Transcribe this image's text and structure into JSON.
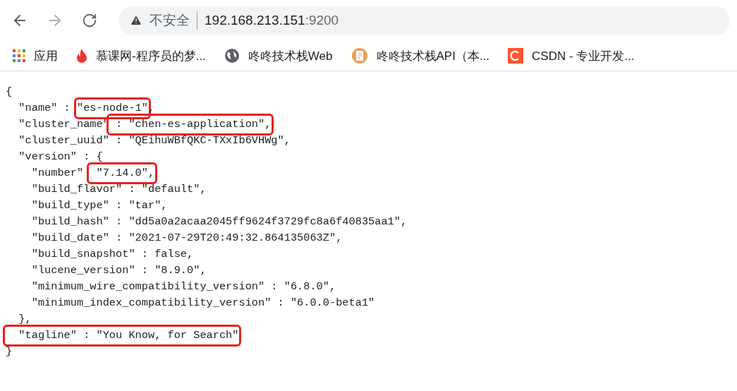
{
  "address_bar": {
    "security_label": "不安全",
    "url_host": "192.168.213.151",
    "url_port": ":9200"
  },
  "bookmarks": [
    {
      "kind": "apps",
      "label": "应用"
    },
    {
      "kind": "flame",
      "label": "慕课网-程序员的梦..."
    },
    {
      "kind": "globe",
      "label": "咚咚技术栈Web"
    },
    {
      "kind": "document",
      "label": "咚咚技术栈API（本..."
    },
    {
      "kind": "csdn",
      "label": "CSDN - 专业开发..."
    }
  ],
  "json_lines": [
    [
      {
        "text": "{",
        "marked": false
      }
    ],
    [
      {
        "text": "  \"name\" : ",
        "marked": false
      },
      {
        "text": "\"es-node-1\"",
        "marked": true
      },
      {
        "text": ",",
        "marked": false
      }
    ],
    [
      {
        "text": "  \"cluster_name\"",
        "marked": false
      },
      {
        "text": " : \"chen-es-application\",",
        "marked": true
      }
    ],
    [
      {
        "text": "  \"cluster_uuid\" : \"QEihuWBfQKC-TXxIb6VHWg\",",
        "marked": false
      }
    ],
    [
      {
        "text": "  \"version\" : {",
        "marked": false
      }
    ],
    [
      {
        "text": "    \"number\" ",
        "marked": false
      },
      {
        "text": " \"7.14.0\",",
        "marked": true
      }
    ],
    [
      {
        "text": "    \"build_flavor\" : \"default\",",
        "marked": false
      }
    ],
    [
      {
        "text": "    \"build_type\" : \"tar\",",
        "marked": false
      }
    ],
    [
      {
        "text": "    \"build_hash\" : \"dd5a0a2acaa2045ff9624f3729fc8a6f40835aa1\",",
        "marked": false
      }
    ],
    [
      {
        "text": "    \"build_date\" : \"2021-07-29T20:49:32.864135063Z\",",
        "marked": false
      }
    ],
    [
      {
        "text": "    \"build_snapshot\" : false,",
        "marked": false
      }
    ],
    [
      {
        "text": "    \"lucene_version\" : \"8.9.0\",",
        "marked": false
      }
    ],
    [
      {
        "text": "    \"minimum_wire_compatibility_version\" : \"6.8.0\",",
        "marked": false
      }
    ],
    [
      {
        "text": "    \"minimum_index_compatibility_version\" : \"6.0.0-beta1\"",
        "marked": false
      }
    ],
    [
      {
        "text": "  },",
        "marked": false
      }
    ],
    [
      {
        "text": "  \"tagline\" : \"You Know, for Search\"",
        "marked": true
      }
    ],
    [
      {
        "text": "}",
        "marked": false
      }
    ]
  ]
}
